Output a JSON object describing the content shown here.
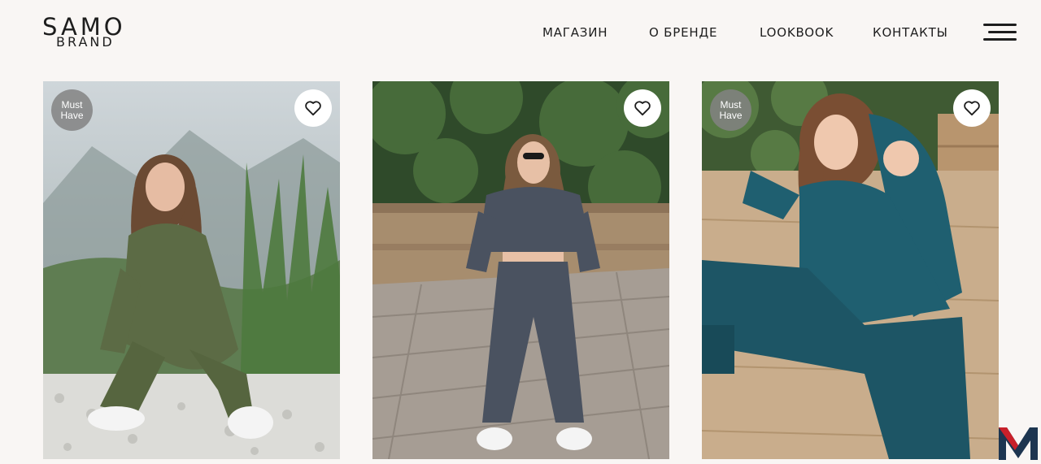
{
  "brand": {
    "line1": "SAMO",
    "line2": "BRAND"
  },
  "nav": {
    "items": [
      {
        "label": "МАГАЗИН"
      },
      {
        "label": "О БРЕНДЕ"
      },
      {
        "label": "LOOKBOOK"
      },
      {
        "label": "КОНТАКТЫ"
      }
    ]
  },
  "products": [
    {
      "badge_line1": "Must",
      "badge_line2": "Have",
      "outfit_color": "#5c6b45",
      "icon": "heart-icon"
    },
    {
      "badge_line1": "",
      "badge_line2": "",
      "outfit_color": "#4a5260",
      "icon": "heart-icon"
    },
    {
      "badge_line1": "Must",
      "badge_line2": "Have",
      "outfit_color": "#1f5f70",
      "icon": "heart-icon"
    }
  ],
  "colors": {
    "background": "#f9f6f4",
    "text": "#1d1d1d",
    "badge": "#828282",
    "corner_logo_dark": "#1d3550",
    "corner_logo_red": "#c8202a"
  }
}
